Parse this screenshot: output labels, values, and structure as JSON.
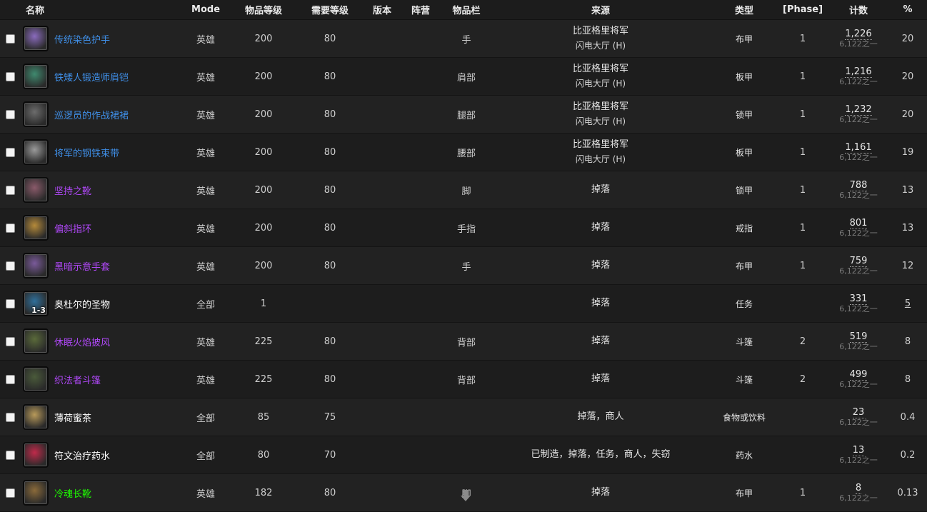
{
  "headers": {
    "name": "名称",
    "mode": "Mode",
    "item_level": "物品等级",
    "req_level": "需要等级",
    "version": "版本",
    "faction": "阵营",
    "slot": "物品栏",
    "source": "来源",
    "type": "类型",
    "phase": "[Phase]",
    "count": "计数",
    "pct": "%"
  },
  "rows": [
    {
      "name": "传统染色护手",
      "quality": "rare",
      "icon": "gauntlet-icon",
      "icon_color": "#8a6bbd",
      "badge": "",
      "mode": "英雄",
      "ilvl": "200",
      "req": "80",
      "slot": "手",
      "source1": "比亚格里将军",
      "source2": "闪电大厅 (H)",
      "type": "布甲",
      "phase": "1",
      "count": "1,226",
      "of": "6,122之一",
      "pct": "20"
    },
    {
      "name": "铁矮人锻造师肩铠",
      "quality": "rare",
      "icon": "shoulder-icon",
      "icon_color": "#3f8a6f",
      "badge": "",
      "mode": "英雄",
      "ilvl": "200",
      "req": "80",
      "slot": "肩部",
      "source1": "比亚格里将军",
      "source2": "闪电大厅 (H)",
      "type": "板甲",
      "phase": "1",
      "count": "1,216",
      "of": "6,122之一",
      "pct": "20"
    },
    {
      "name": "巡逻员的作战裙裙",
      "quality": "rare",
      "icon": "chain-legs-icon",
      "icon_color": "#6c6c6c",
      "badge": "",
      "mode": "英雄",
      "ilvl": "200",
      "req": "80",
      "slot": "腿部",
      "source1": "比亚格里将军",
      "source2": "闪电大厅 (H)",
      "type": "锁甲",
      "phase": "1",
      "count": "1,232",
      "of": "6,122之一",
      "pct": "20"
    },
    {
      "name": "将军的钢铁束带",
      "quality": "rare",
      "icon": "belt-icon",
      "icon_color": "#9a9a9a",
      "badge": "",
      "mode": "英雄",
      "ilvl": "200",
      "req": "80",
      "slot": "腰部",
      "source1": "比亚格里将军",
      "source2": "闪电大厅 (H)",
      "type": "板甲",
      "phase": "1",
      "count": "1,161",
      "of": "6,122之一",
      "pct": "19"
    },
    {
      "name": "坚持之靴",
      "quality": "epic",
      "icon": "boots-icon",
      "icon_color": "#8a5a6a",
      "badge": "",
      "mode": "英雄",
      "ilvl": "200",
      "req": "80",
      "slot": "脚",
      "source1": "掉落",
      "source2": "",
      "type": "锁甲",
      "phase": "1",
      "count": "788",
      "of": "6,122之一",
      "pct": "13"
    },
    {
      "name": "偏斜指环",
      "quality": "epic",
      "icon": "ring-icon",
      "icon_color": "#b58a3a",
      "badge": "",
      "mode": "英雄",
      "ilvl": "200",
      "req": "80",
      "slot": "手指",
      "source1": "掉落",
      "source2": "",
      "type": "戒指",
      "phase": "1",
      "count": "801",
      "of": "6,122之一",
      "pct": "13"
    },
    {
      "name": "黑暗示意手套",
      "quality": "epic",
      "icon": "glove-icon",
      "icon_color": "#7a5a9a",
      "badge": "",
      "mode": "英雄",
      "ilvl": "200",
      "req": "80",
      "slot": "手",
      "source1": "掉落",
      "source2": "",
      "type": "布甲",
      "phase": "1",
      "count": "759",
      "of": "6,122之一",
      "pct": "12"
    },
    {
      "name": "奥杜尔的圣物",
      "quality": "common",
      "icon": "relic-icon",
      "icon_color": "#2f6f9a",
      "badge": "1-3",
      "mode": "全部",
      "ilvl": "1",
      "req": "",
      "slot": "",
      "source1": "掉落",
      "source2": "",
      "type": "任务",
      "phase": "",
      "count": "331",
      "of": "6,122之一",
      "pct": "5",
      "pct_link": true
    },
    {
      "name": "休眠火焰披风",
      "quality": "epic",
      "icon": "cloak-icon",
      "icon_color": "#5a6a3a",
      "badge": "",
      "mode": "英雄",
      "ilvl": "225",
      "req": "80",
      "slot": "背部",
      "source1": "掉落",
      "source2": "",
      "type": "斗篷",
      "phase": "2",
      "count": "519",
      "of": "6,122之一",
      "pct": "8"
    },
    {
      "name": "织法者斗篷",
      "quality": "epic",
      "icon": "cloak-icon",
      "icon_color": "#4a5a3a",
      "badge": "",
      "mode": "英雄",
      "ilvl": "225",
      "req": "80",
      "slot": "背部",
      "source1": "掉落",
      "source2": "",
      "type": "斗篷",
      "phase": "2",
      "count": "499",
      "of": "6,122之一",
      "pct": "8"
    },
    {
      "name": "薄荷蜜茶",
      "quality": "common",
      "icon": "tea-icon",
      "icon_color": "#b89a5a",
      "badge": "",
      "mode": "全部",
      "ilvl": "85",
      "req": "75",
      "slot": "",
      "source1": "掉落，商人",
      "source2": "",
      "type": "食物或饮料",
      "phase": "",
      "count": "23",
      "of": "6,122之一",
      "pct": "0.4"
    },
    {
      "name": "符文治疗药水",
      "quality": "common",
      "icon": "potion-icon",
      "icon_color": "#c02a4a",
      "badge": "",
      "mode": "全部",
      "ilvl": "80",
      "req": "70",
      "slot": "",
      "source1": "已制造，掉落，任务，商人，失窃",
      "source2": "",
      "type": "药水",
      "phase": "",
      "count": "13",
      "of": "6,122之一",
      "pct": "0.2"
    },
    {
      "name": "冷魂长靴",
      "quality": "uncommon",
      "icon": "boots-icon",
      "icon_color": "#8a6a3a",
      "badge": "",
      "mode": "英雄",
      "ilvl": "182",
      "req": "80",
      "slot": "脚",
      "source1": "掉落",
      "source2": "",
      "type": "布甲",
      "phase": "1",
      "count": "8",
      "of": "6,122之一",
      "pct": "0.13"
    }
  ]
}
